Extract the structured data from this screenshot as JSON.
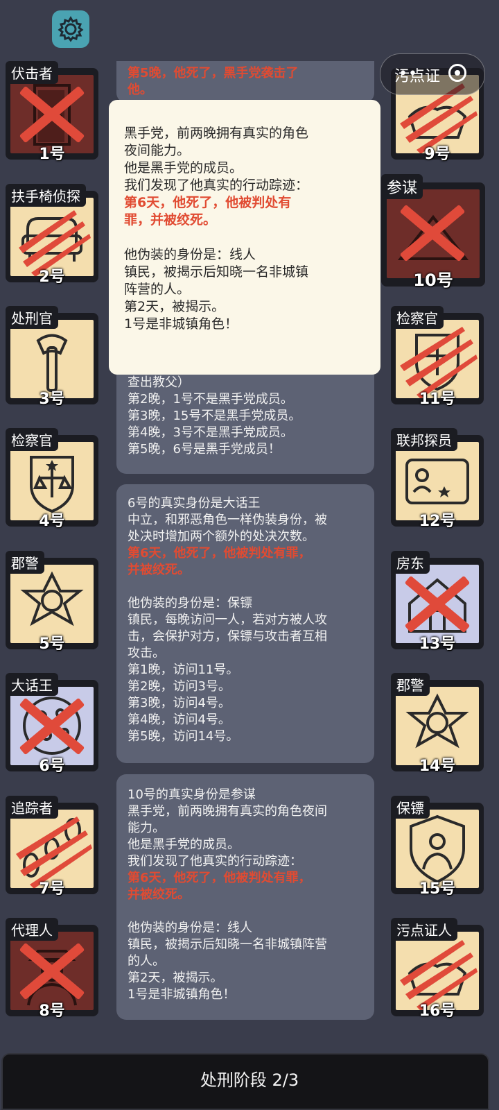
{
  "settings": {
    "icon": "gear-icon"
  },
  "top_capsule": {
    "partial_text": "污点证",
    "dots": "••",
    "icon": "target-icon"
  },
  "colors": {
    "background": "#3a3d4c",
    "card_frame": "#1b1c22",
    "card_face": "#f4deae",
    "dead_face": "#6e2d29",
    "accent_red": "#e14b32",
    "settings_teal": "#4aa3b2"
  },
  "players": [
    {
      "num": "1号",
      "role": "伏击者",
      "icon": "door-icon",
      "status": "dead-x"
    },
    {
      "num": "2号",
      "role": "扶手椅侦探",
      "icon": "armchair-icon",
      "status": "clawed"
    },
    {
      "num": "3号",
      "role": "处刑官",
      "icon": "axe-icon",
      "status": "alive"
    },
    {
      "num": "4号",
      "role": "检察官",
      "icon": "scales-badge-icon",
      "status": "alive"
    },
    {
      "num": "5号",
      "role": "郡警",
      "icon": "sheriff-star-icon",
      "status": "alive"
    },
    {
      "num": "6号",
      "role": "大话王",
      "icon": "pizza-icon",
      "status": "dead-x"
    },
    {
      "num": "7号",
      "role": "追踪者",
      "icon": "footprints-icon",
      "status": "clawed"
    },
    {
      "num": "8号",
      "role": "代理人",
      "icon": "agent-icon",
      "status": "dead-x"
    },
    {
      "num": "9号",
      "role": "",
      "icon": "witness-icon",
      "status": "clawed"
    },
    {
      "num": "10号",
      "role": "参谋",
      "icon": "strategist-icon",
      "status": "dead-x"
    },
    {
      "num": "11号",
      "role": "检察官",
      "icon": "scales-badge-icon",
      "status": "clawed"
    },
    {
      "num": "12号",
      "role": "联邦探员",
      "icon": "fbi-card-icon",
      "status": "alive"
    },
    {
      "num": "13号",
      "role": "房东",
      "icon": "house-icon",
      "status": "dead-x"
    },
    {
      "num": "14号",
      "role": "郡警",
      "icon": "sheriff-star-icon",
      "status": "alive"
    },
    {
      "num": "15号",
      "role": "保镖",
      "icon": "bodyguard-shield-icon",
      "status": "alive"
    },
    {
      "num": "16号",
      "role": "污点证人",
      "icon": "witness-icon",
      "status": "clawed"
    }
  ],
  "panel_top": {
    "lines": [
      "第5晚，他死了，黑手党袭击了",
      "他。"
    ]
  },
  "panel_2": {
    "lines": [
      "查出教父）",
      "第2晚，1号不是黑手党成员。",
      "第3晚，15号不是黑手党成员。",
      "第4晚，3号不是黑手党成员。",
      "第5晚，6号是黑手党成员！"
    ]
  },
  "panel_3": {
    "line1": "6号的真实身份是大话王",
    "line2": "中立，和邪恶角色一样伪装身份，被",
    "line3": "处决时增加两个额外的处决次数。",
    "red1": "第6天，他死了，他被判处有罪，",
    "red2": "并被绞死。",
    "line4": "他伪装的身份是：保镖",
    "line5": "镇民，每晚访问一人，若对方被人攻",
    "line6": "击，会保护对方，保镖与攻击者互相",
    "line7": "攻击。",
    "line8": "第1晚，访问11号。",
    "line9": "第2晚，访问3号。",
    "line10": "第3晚，访问4号。",
    "line11": "第4晚，访问4号。",
    "line12": "第5晚，访问14号。"
  },
  "panel_4": {
    "line1": "10号的真实身份是参谋",
    "line2": "黑手党，前两晚拥有真实的角色夜间",
    "line3": "能力。",
    "line4": "他是黑手党的成员。",
    "line5": "我们发现了他真实的行动踪迹：",
    "red1": "第6天，他死了，他被判处有罪，",
    "red2": "并被绞死。",
    "line6": "他伪装的身份是：线人",
    "line7": "镇民，被揭示后知晓一名非城镇阵营",
    "line8": "的人。",
    "line9": "第2天，被揭示。",
    "line10": "1号是非城镇角色！"
  },
  "popup": {
    "line1": "黑手党，前两晚拥有真实的角色",
    "line2": "夜间能力。",
    "line3": "他是黑手党的成员。",
    "line4": "我们发现了他真实的行动踪迹：",
    "red1": "第6天，他死了，他被判处有",
    "red2": "罪，并被绞死。",
    "line5": "他伪装的身份是：线人",
    "line6": "镇民，被揭示后知晓一名非城镇",
    "line7": "阵营的人。",
    "line8": "第2天，被揭示。",
    "line9": "1号是非城镇角色！"
  },
  "bottom_bar": {
    "label": "处刑阶段 2/3"
  }
}
